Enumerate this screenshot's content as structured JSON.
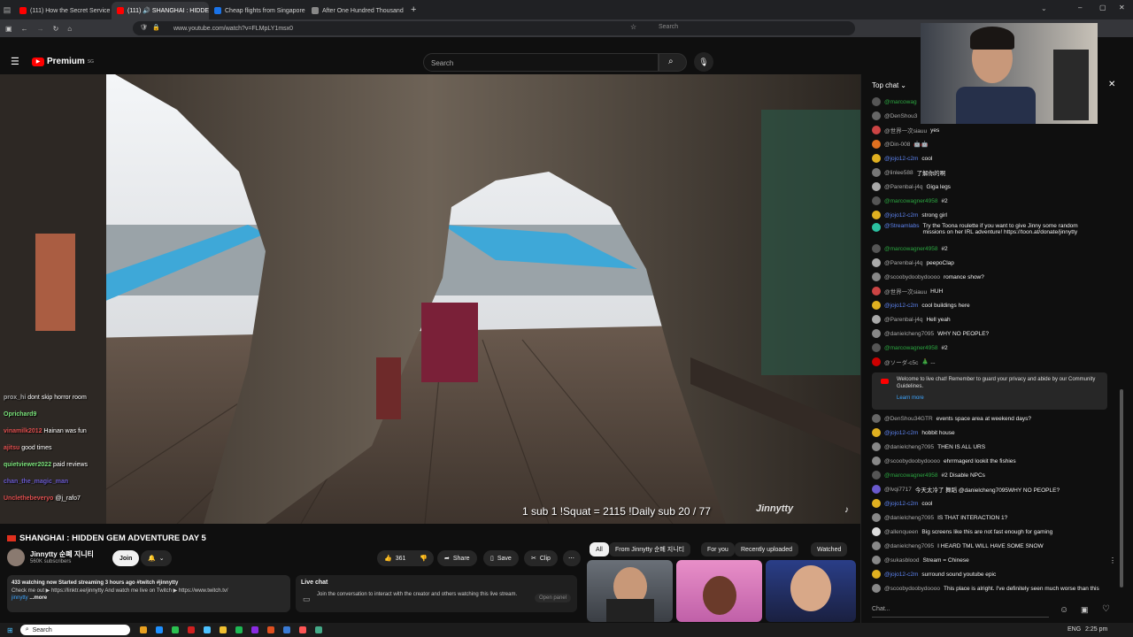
{
  "browser": {
    "tabs": [
      {
        "label": "(111) How the Secret Service A",
        "color": "#ff0000"
      },
      {
        "label": "(111) 🔊 SHANGHAI : HIDDE",
        "color": "#ff0000"
      },
      {
        "label": "Cheap flights from Singapore t",
        "color": "#1a73e8"
      },
      {
        "label": "After One Hundred Thousand D",
        "color": "#888888"
      }
    ],
    "url": "www.youtube.com/watch?v=FLMpLY1msx0",
    "search_placeholder": "Search"
  },
  "youtube": {
    "logo": "Premium",
    "logo_sup": "SG",
    "search_placeholder": "Search"
  },
  "overlay": {
    "chat": [
      {
        "user": "prox_hi",
        "text": "dont skip horror room",
        "color": "#aaaaaa"
      },
      {
        "user": "Oprichard9",
        "text": "",
        "color": "#7be37b"
      },
      {
        "user": "vinamilk2012",
        "text": "Hainan was fun",
        "color": "#e05050"
      },
      {
        "user": "ajitsu",
        "text": "good times",
        "color": "#e05050"
      },
      {
        "user": "quietviewer2022",
        "text": "paid reviews",
        "color": "#7be37b"
      },
      {
        "user": "chan_the_magic_man",
        "text": "",
        "color": "#6a5acd"
      },
      {
        "user": "Unclethebeveryo",
        "text": "@j_rafo7",
        "color": "#e05050"
      }
    ],
    "stats": "1 sub 1 !Squat = 2115   !Daily sub 20 / 77",
    "watermark": "Jinnytty"
  },
  "video": {
    "title": "SHANGHAI : HIDDEN GEM ADVENTURE DAY 5",
    "channel": "Jinnytty 순폐 지니티",
    "subscribers": "560K subscribers",
    "join": "Join",
    "likes": "361",
    "share": "Share",
    "save": "Save",
    "clip": "Clip",
    "desc_line1": "433 watching now  Started streaming 3 hours ago  #twitch #jinnytty",
    "desc_line2": "Check me out ▶ https://linktr.ee/jinnytty  And watch me live on Twitch ▶ https://www.twitch.tv/",
    "desc_line3": "jinnytty",
    "desc_more": "...more",
    "livechat_title": "Live chat",
    "livechat_text": "Join the conversation to interact with the creator and others watching this live stream.",
    "open_panel": "Open panel"
  },
  "chips": [
    "All",
    "From Jinnytty 순폐 지니티",
    "For you",
    "Recently uploaded",
    "Watched"
  ],
  "chat": {
    "header": "Top chat",
    "messages": [
      {
        "user": "@marcowag",
        "text": "",
        "ucls": "gr",
        "av": "#555"
      },
      {
        "user": "@DenShou3",
        "text": "",
        "ucls": "",
        "av": "#666"
      },
      {
        "user": "@世界一次siauu",
        "text": "yes",
        "ucls": "",
        "av": "#c44"
      },
      {
        "user": "@Din-008",
        "text": "🤖🤖",
        "ucls": "",
        "av": "#e07020"
      },
      {
        "user": "@jojo12-c2m",
        "text": "cool",
        "ucls": "mod",
        "av": "#e0b020"
      },
      {
        "user": "@linlee588",
        "text": "了解你的啊",
        "ucls": "",
        "av": "#777"
      },
      {
        "user": "@Parenbal-j4q",
        "text": "Giga legs",
        "ucls": "",
        "av": "#aaa"
      },
      {
        "user": "@marcowagner4958",
        "text": "#2",
        "ucls": "gr",
        "av": "#555"
      },
      {
        "user": "@jojo12-c2m",
        "text": "strong girl",
        "ucls": "mod",
        "av": "#e0b020"
      },
      {
        "user": "@Streamlabs",
        "text": "Try the Toona roulette if you want to give Jinny some random missions on her IRL adventure! https://toon.at/donate/jinnytty",
        "ucls": "mod",
        "av": "#2bc0a0"
      },
      {
        "user": "@marcowagner4958",
        "text": "#2",
        "ucls": "gr",
        "av": "#555"
      },
      {
        "user": "@Parenbal-j4q",
        "text": "peepoClap",
        "ucls": "",
        "av": "#aaa"
      },
      {
        "user": "@scoobydoobydoooo",
        "text": "romance show?",
        "ucls": "",
        "av": "#888"
      },
      {
        "user": "@世界一次siauu",
        "text": "HUH",
        "ucls": "",
        "av": "#c44"
      },
      {
        "user": "@jojo12-c2m",
        "text": "cool buildings here",
        "ucls": "mod",
        "av": "#e0b020"
      },
      {
        "user": "@Parenbal-j4q",
        "text": "Hell yeah",
        "ucls": "",
        "av": "#aaa"
      },
      {
        "user": "@danielcheng7095",
        "text": "WHY NO PEOPLE?",
        "ucls": "",
        "av": "#888"
      },
      {
        "user": "@marcowagner4958",
        "text": "#2",
        "ucls": "gr",
        "av": "#555"
      },
      {
        "user": "@ソーダ-c5c",
        "text": "🎄 ...",
        "ucls": "",
        "av": "#c00"
      }
    ],
    "notice_text": "Welcome to live chat! Remember to guard your privacy and abide by our Community Guidelines.",
    "notice_link": "Learn more",
    "messages2": [
      {
        "user": "@DenShou34GTR",
        "text": "events space area at weekend days?",
        "ucls": "",
        "av": "#666"
      },
      {
        "user": "@jojo12-c2m",
        "text": "hobbit house",
        "ucls": "mod",
        "av": "#e0b020"
      },
      {
        "user": "@danielcheng7095",
        "text": "THEN IS ALL URS",
        "ucls": "",
        "av": "#888"
      },
      {
        "user": "@scoobydoobydoooo",
        "text": "ehrrmagerd lookit the fishies",
        "ucls": "",
        "av": "#888"
      },
      {
        "user": "@marcowagner4958",
        "text": "#2  Disable NPCs",
        "ucls": "gr",
        "av": "#555"
      },
      {
        "user": "@lvqi7717",
        "text": "今天太冷了 舞蹈 @danielcheng7095WHY NO PEOPLE?",
        "ucls": "",
        "av": "#6a5acd"
      },
      {
        "user": "@jojo12-c2m",
        "text": "cool",
        "ucls": "mod",
        "av": "#e0b020"
      },
      {
        "user": "@danielcheng7095",
        "text": "IS THAT INTERACTION 1?",
        "ucls": "",
        "av": "#888"
      },
      {
        "user": "@allenqueen",
        "text": "Big screens like this are not fast enough for gaming",
        "ucls": "",
        "av": "#ddd"
      },
      {
        "user": "@danielcheng7095",
        "text": "I HEARD TML WILL HAVE SOME SNOW",
        "ucls": "",
        "av": "#888"
      },
      {
        "user": "@sukasblood",
        "text": "Stream = Chinese",
        "ucls": "",
        "av": "#888"
      },
      {
        "user": "@jojo12-c2m",
        "text": "surround sound youtube epic",
        "ucls": "mod",
        "av": "#e0b020"
      },
      {
        "user": "@scoobydoobydoooo",
        "text": "This place is alright. I've definitely seen much worse than this",
        "ucls": "",
        "av": "#888"
      }
    ],
    "input_placeholder": "Chat..."
  },
  "taskbar": {
    "search": "Search",
    "lang": "ENG",
    "time": "2:25 pm"
  }
}
